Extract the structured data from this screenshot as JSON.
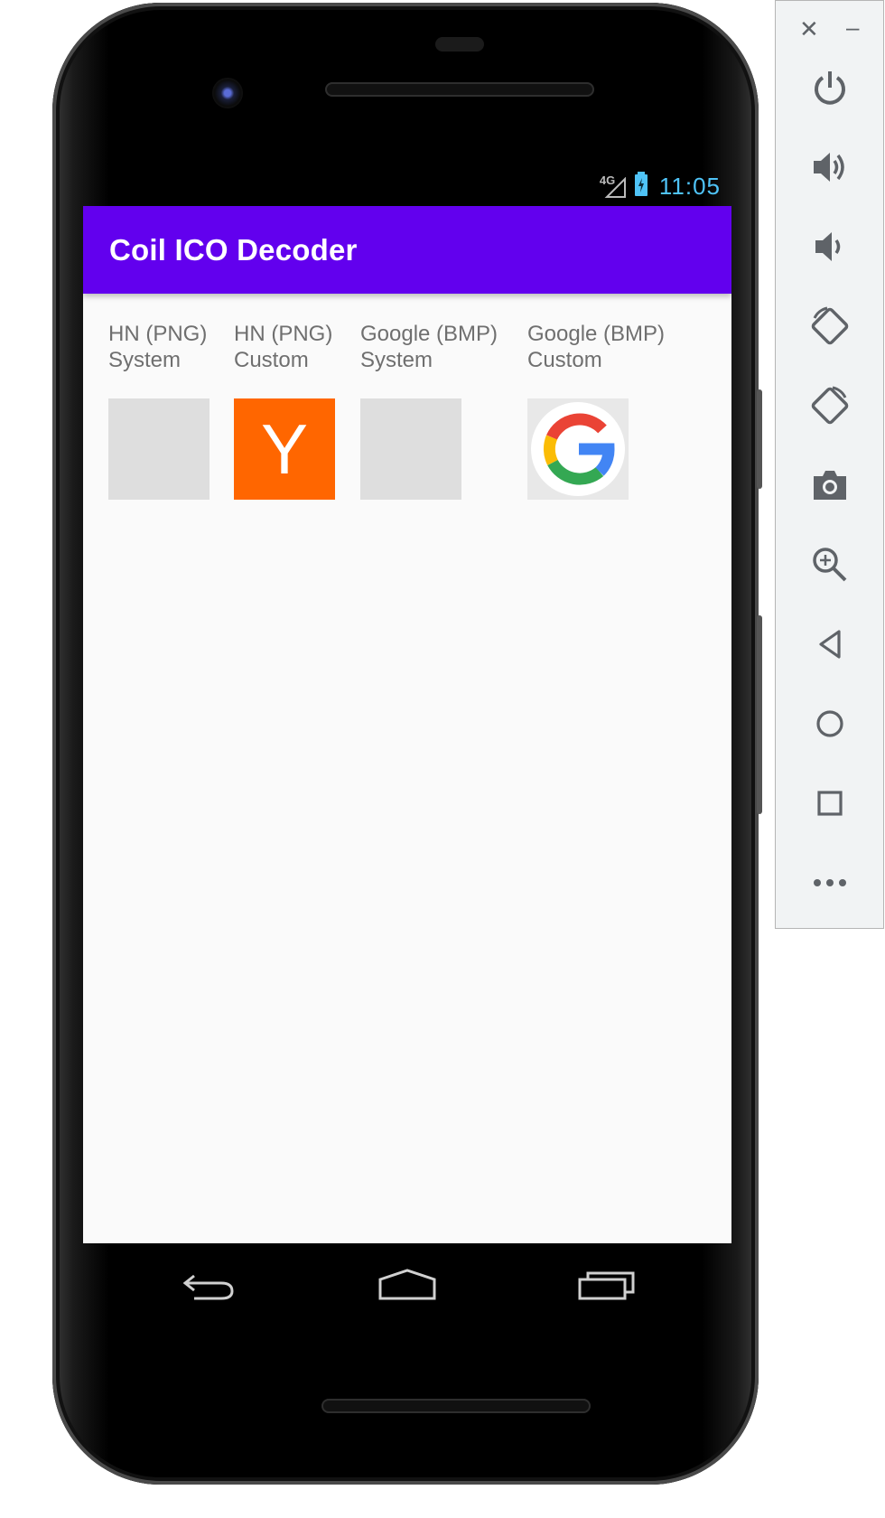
{
  "status_bar": {
    "network_label": "4G",
    "time": "11:05"
  },
  "app": {
    "title": "Coil ICO Decoder"
  },
  "icons_grid": [
    {
      "line1": "HN (PNG)",
      "line2": "System",
      "state": "placeholder"
    },
    {
      "line1": "HN (PNG)",
      "line2": "Custom",
      "state": "hacker-news-logo",
      "glyph": "Y"
    },
    {
      "line1": "Google (BMP)",
      "line2": "System",
      "state": "placeholder"
    },
    {
      "line1": "Google (BMP)",
      "line2": "Custom",
      "state": "google-logo"
    }
  ],
  "colors": {
    "app_bar": "#6200ee",
    "clock": "#4fc3f7",
    "hn_orange": "#ff6600",
    "placeholder": "#dedede"
  },
  "emulator_panel": {
    "window_buttons": [
      "close-icon",
      "minimize-icon"
    ],
    "tools": [
      "power-icon",
      "volume-up-icon",
      "volume-down-icon",
      "rotate-left-icon",
      "rotate-right-icon",
      "camera-icon",
      "zoom-icon",
      "back-icon",
      "home-icon",
      "overview-icon",
      "more-icon"
    ],
    "close_glyph": "✕",
    "minimize_glyph": "–"
  }
}
